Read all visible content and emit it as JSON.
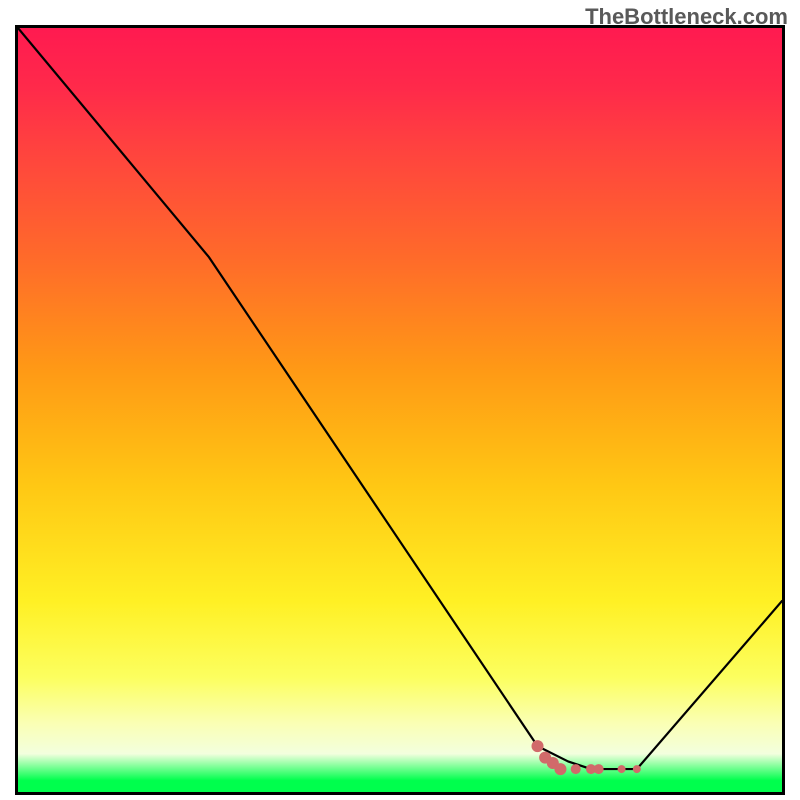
{
  "watermark": "TheBottleneck.com",
  "chart_data": {
    "type": "line",
    "title": "",
    "xlabel": "",
    "ylabel": "",
    "xlim": [
      0,
      100
    ],
    "ylim": [
      0,
      100
    ],
    "series": [
      {
        "name": "bottleneck-curve",
        "x": [
          0,
          25,
          68,
          72,
          75,
          77,
          79,
          81,
          100
        ],
        "values": [
          100,
          70,
          6,
          4,
          3,
          3,
          3,
          3,
          25
        ]
      }
    ],
    "markers": {
      "name": "highlight-points",
      "color": "#d16a6a",
      "points": [
        {
          "x": 68,
          "y": 6,
          "size": 6
        },
        {
          "x": 69,
          "y": 4.5,
          "size": 6
        },
        {
          "x": 70,
          "y": 3.8,
          "size": 6
        },
        {
          "x": 71,
          "y": 3,
          "size": 6
        },
        {
          "x": 73,
          "y": 3,
          "size": 5
        },
        {
          "x": 75,
          "y": 3,
          "size": 5
        },
        {
          "x": 76,
          "y": 3,
          "size": 5
        },
        {
          "x": 79,
          "y": 3,
          "size": 4
        },
        {
          "x": 81,
          "y": 3,
          "size": 4
        }
      ]
    },
    "gradient_background": true
  }
}
